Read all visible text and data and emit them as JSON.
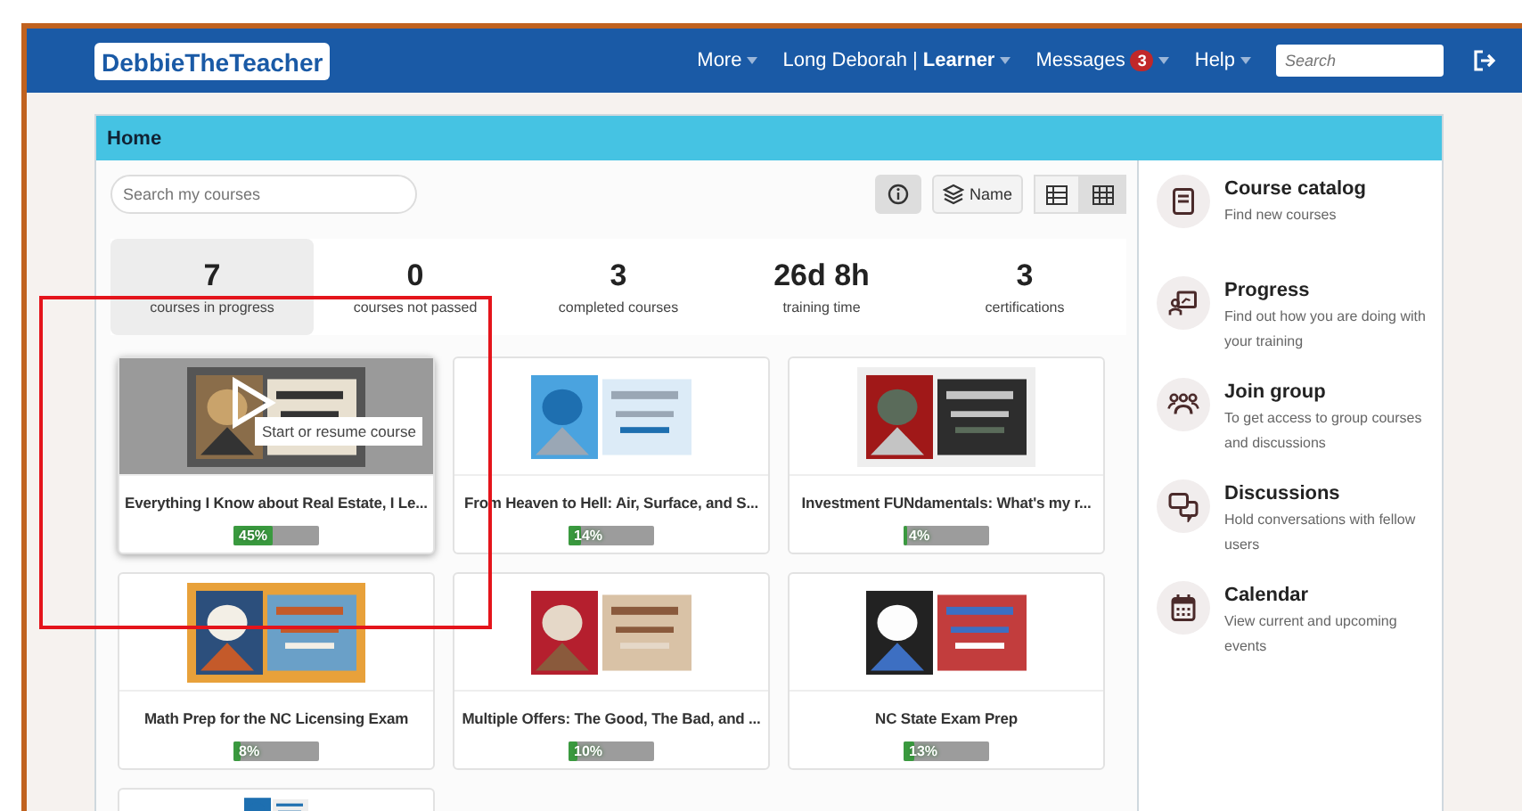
{
  "header": {
    "logo": "DebbieTheTeacher",
    "nav": [
      {
        "label": "More",
        "kind": "menu"
      },
      {
        "label": "Long Deborah | **Learner**",
        "kind": "menu"
      },
      {
        "label": "Messages",
        "kind": "menu",
        "badge": "3"
      },
      {
        "label": "Help",
        "kind": "menu"
      }
    ],
    "search": {
      "placeholder": "Search"
    }
  },
  "panel": {
    "title": "Home"
  },
  "course_search": {
    "placeholder": "Search my courses"
  },
  "toolbar": {
    "sort_label": "Name",
    "info_selected": true,
    "views": [
      {
        "kind": "list",
        "selected": false
      },
      {
        "kind": "grid",
        "selected": true
      }
    ]
  },
  "stats": [
    {
      "value": "7",
      "label": "courses in progress",
      "selected": true
    },
    {
      "value": "0",
      "label": "courses not passed",
      "selected": false
    },
    {
      "value": "3",
      "label": "completed courses",
      "selected": false
    },
    {
      "value": "26d 8h",
      "label": "training time",
      "selected": false
    },
    {
      "value": "3",
      "label": "certifications",
      "selected": false
    }
  ],
  "courses": [
    {
      "kind": "course",
      "title": "Everything I Know about Real Estate, I Le...",
      "progress": "45%",
      "level": 0.45,
      "hovered": true,
      "tooltip": "Start or resume course"
    },
    {
      "kind": "course",
      "title": "From Heaven to Hell: Air, Surface, and S...",
      "progress": "14%",
      "level": 0.14,
      "hovered": false
    },
    {
      "kind": "course",
      "title": "Investment FUNdamentals: What's my r...",
      "progress": "4%",
      "level": 0.04,
      "hovered": false
    },
    {
      "kind": "course",
      "title": "Math Prep for the NC Licensing Exam",
      "progress": "8%",
      "level": 0.08,
      "hovered": false
    },
    {
      "kind": "course",
      "title": "Multiple Offers: The Good, The Bad, and ...",
      "progress": "10%",
      "level": 0.1,
      "hovered": false
    },
    {
      "kind": "course",
      "title": "NC State Exam Prep",
      "progress": "13%",
      "level": 0.13,
      "hovered": false
    },
    {
      "kind": "partial"
    }
  ],
  "sidebar": [
    {
      "title": "Course catalog",
      "description": "Find new courses"
    },
    {
      "title": "Progress",
      "description": "Find out how you are doing with your training"
    },
    {
      "title": "Join group",
      "description": "To get access to group courses and discussions"
    },
    {
      "title": "Discussions",
      "description": "Hold conversations with fellow users"
    },
    {
      "title": "Calendar",
      "description": "View current and upcoming events"
    }
  ]
}
